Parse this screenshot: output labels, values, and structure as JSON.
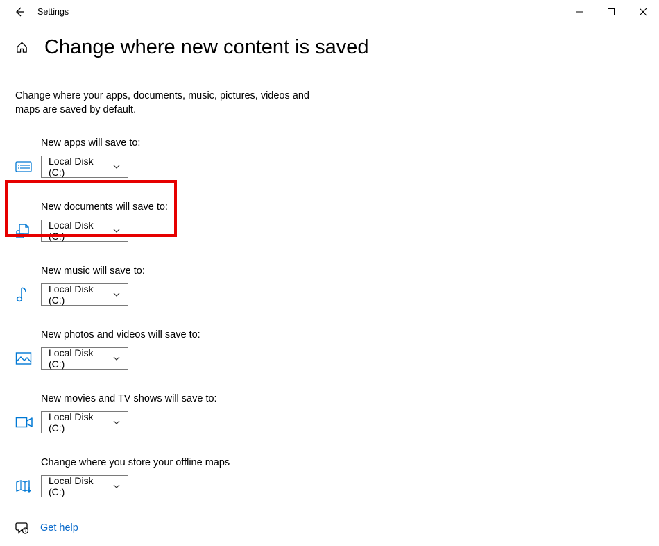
{
  "window": {
    "title": "Settings"
  },
  "page": {
    "heading": "Change where new content is saved",
    "description": "Change where your apps, documents, music, pictures, videos and maps are saved by default."
  },
  "settings": {
    "apps": {
      "label": "New apps will save to:",
      "value": "Local Disk (C:)"
    },
    "docs": {
      "label": "New documents will save to:",
      "value": "Local Disk (C:)"
    },
    "music": {
      "label": "New music will save to:",
      "value": "Local Disk (C:)"
    },
    "photos": {
      "label": "New photos and videos will save to:",
      "value": "Local Disk (C:)"
    },
    "movies": {
      "label": "New movies and TV shows will save to:",
      "value": "Local Disk (C:)"
    },
    "maps": {
      "label": "Change where you store your offline maps",
      "value": "Local Disk (C:)"
    }
  },
  "help": {
    "label": "Get help"
  },
  "colors": {
    "accent": "#0078d4",
    "highlight": "#e60000"
  }
}
